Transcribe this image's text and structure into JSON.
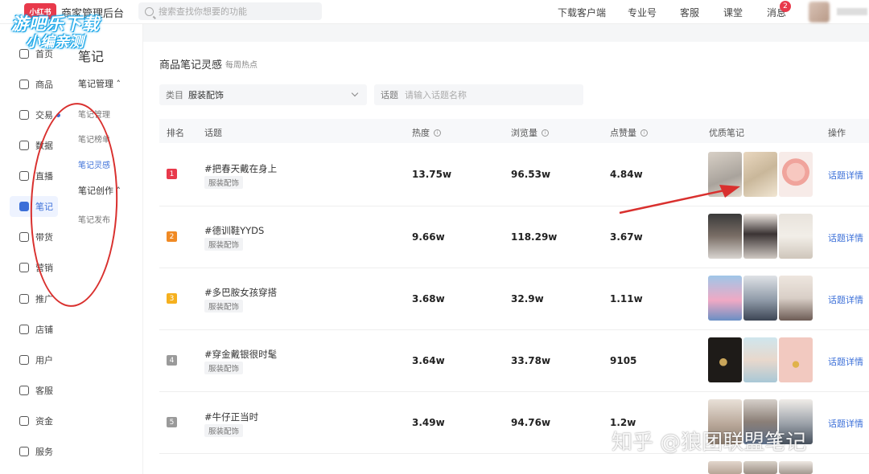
{
  "header": {
    "logo_text": "小红书",
    "brand_title": "商家管理后台",
    "search_placeholder": "搜索查找你想要的功能",
    "nav": [
      "下载客户端",
      "专业号",
      "客服",
      "课堂",
      "消息"
    ],
    "message_count": "2"
  },
  "watermark": {
    "line1": "游吧乐下载",
    "line2": "小编亲测",
    "bottom": "知乎 @狼团联盟笔记"
  },
  "sidebar": {
    "items": [
      {
        "label": "首页",
        "icon": "home-icon"
      },
      {
        "label": "商品",
        "icon": "product-icon"
      },
      {
        "label": "交易",
        "icon": "trade-icon"
      },
      {
        "label": "数据",
        "icon": "data-icon"
      },
      {
        "label": "直播",
        "icon": "live-icon"
      },
      {
        "label": "笔记",
        "icon": "note-icon"
      },
      {
        "label": "带货",
        "icon": "sell-icon"
      },
      {
        "label": "营销",
        "icon": "marketing-icon"
      },
      {
        "label": "推广",
        "icon": "promotion-icon"
      },
      {
        "label": "店铺",
        "icon": "shop-icon"
      },
      {
        "label": "用户",
        "icon": "user-icon"
      },
      {
        "label": "客服",
        "icon": "service-icon"
      },
      {
        "label": "资金",
        "icon": "fund-icon"
      },
      {
        "label": "服务",
        "icon": "service-market-icon"
      }
    ],
    "active_color": "#3b6fd8"
  },
  "subnav": {
    "title": "笔记",
    "group1": "笔记管理",
    "group1_items": [
      "笔记管理",
      "笔记榜单",
      "笔记灵感"
    ],
    "group2": "笔记创作",
    "group2_items": [
      "笔记发布"
    ]
  },
  "main": {
    "title": "商品笔记灵感",
    "subtitle": "每周热点",
    "filter_category_label": "类目",
    "filter_category_value": "服装配饰",
    "filter_topic_label": "话题",
    "filter_topic_placeholder": "请输入话题名称",
    "columns": [
      "排名",
      "话题",
      "热度",
      "浏览量",
      "点赞量",
      "优质笔记",
      "操作"
    ],
    "rows": [
      {
        "rank": "1",
        "topic": "#把春天戴在身上",
        "tag": "服装配饰",
        "heat": "13.75w",
        "views": "96.53w",
        "likes": "4.84w",
        "action": "话题详情"
      },
      {
        "rank": "2",
        "topic": "#德训鞋YYDS",
        "tag": "服装配饰",
        "heat": "9.66w",
        "views": "118.29w",
        "likes": "3.67w",
        "action": "话题详情"
      },
      {
        "rank": "3",
        "topic": "#多巴胺女孩穿搭",
        "tag": "服装配饰",
        "heat": "3.68w",
        "views": "32.9w",
        "likes": "1.11w",
        "action": "话题详情"
      },
      {
        "rank": "4",
        "topic": "#穿金戴银很时髦",
        "tag": "服装配饰",
        "heat": "3.64w",
        "views": "33.78w",
        "likes": "9105",
        "action": "话题详情"
      },
      {
        "rank": "5",
        "topic": "#牛仔正当时",
        "tag": "服装配饰",
        "heat": "3.49w",
        "views": "94.76w",
        "likes": "1.2w",
        "action": "话题详情"
      }
    ],
    "rank_colors": [
      "#e8394b",
      "#f08a24",
      "#f5b01e",
      "#9a9a9a",
      "#9a9a9a"
    ]
  }
}
